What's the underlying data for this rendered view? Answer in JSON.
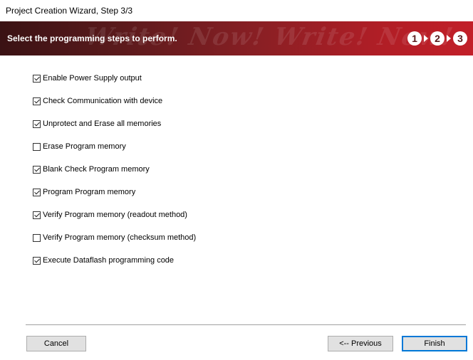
{
  "window": {
    "title": "Project Creation Wizard, Step 3/3"
  },
  "banner": {
    "heading": "Select the programming steps to perform.",
    "watermark": "Write! Now! Write! Now!",
    "steps": [
      "1",
      "2",
      "3"
    ],
    "current_step": 3
  },
  "options": [
    {
      "label": "Enable Power Supply output",
      "checked": true
    },
    {
      "label": "Check Communication with device",
      "checked": true
    },
    {
      "label": "Unprotect and Erase all memories",
      "checked": true
    },
    {
      "label": "Erase Program memory",
      "checked": false
    },
    {
      "label": "Blank Check Program memory",
      "checked": true
    },
    {
      "label": "Program Program memory",
      "checked": true
    },
    {
      "label": "Verify Program memory (readout method)",
      "checked": true
    },
    {
      "label": "Verify Program memory (checksum method)",
      "checked": false
    },
    {
      "label": "Execute Dataflash programming code",
      "checked": true
    }
  ],
  "buttons": {
    "cancel": "Cancel",
    "previous": "<-- Previous",
    "finish": "Finish"
  },
  "colors": {
    "banner_dark": "#3a1214",
    "banner_light": "#c21f28",
    "accent": "#0078d7"
  }
}
